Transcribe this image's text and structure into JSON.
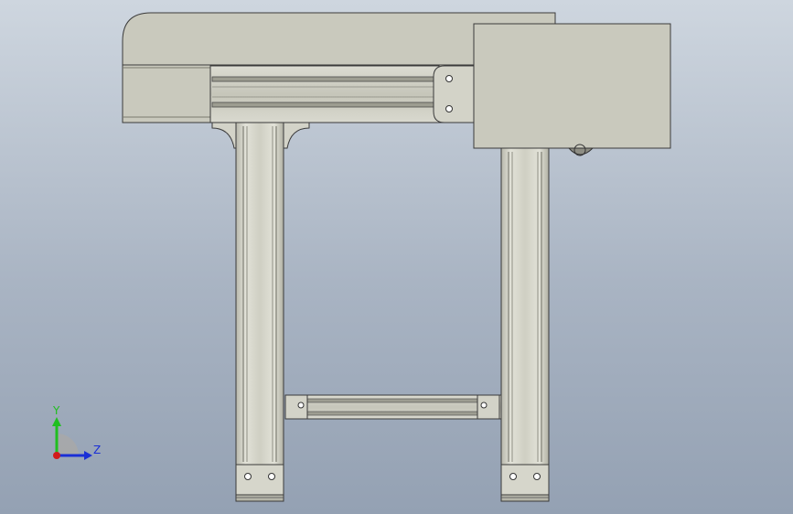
{
  "viewport": {
    "background_top": "#ced6df",
    "background_bottom": "#94a1b3"
  },
  "model": {
    "body_color": "#c9c9bd",
    "rail_color": "#d6d6cb",
    "rail_shade": "#b3b3a6",
    "edge_color": "#3a3a3a",
    "bolt_color": "#ffffff"
  },
  "triad": {
    "y_label": "Y",
    "z_label": "Z",
    "y_color": "#1fbf1f",
    "z_color": "#1a2fd6",
    "x_color": "#d11a1a",
    "icons": [
      "y-axis-arrow-icon",
      "z-axis-arrow-icon",
      "x-axis-dot-icon"
    ]
  }
}
